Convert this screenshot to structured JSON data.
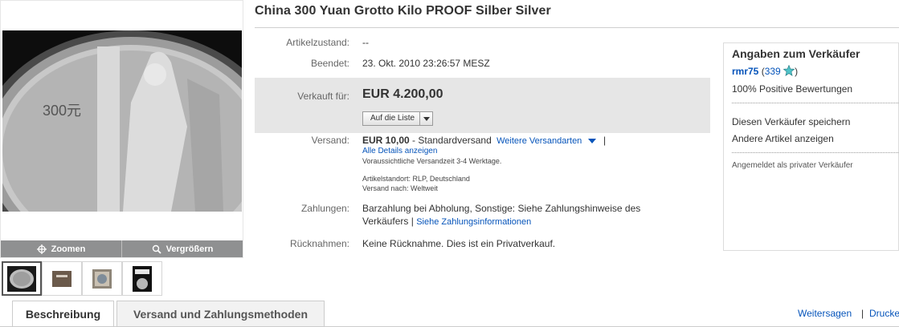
{
  "title": "China 300 Yuan Grotto Kilo PROOF Silber Silver",
  "gallery": {
    "zoom_label": "Zoomen",
    "enlarge_label": "Vergrößern",
    "coin_denomination": "300元",
    "thumb_count": 4
  },
  "details": {
    "condition_label": "Artikelzustand:",
    "condition_value": "--",
    "ended_label": "Beendet:",
    "ended_value": "23. Okt. 2010 23:26:57 MESZ",
    "sold_label": "Verkauft für:",
    "sold_value": "EUR 4.200,00",
    "watch_label": "Auf die Liste",
    "shipping_label": "Versand:",
    "shipping_price": "EUR 10,00",
    "shipping_method": " - Standardversand",
    "shipping_more": "Weitere Versandarten",
    "shipping_all_details": "Alle Details anzeigen",
    "shipping_time": "Voraussichtliche Versandzeit 3-4 Werktage.",
    "item_location": "Artikelstandort: RLP, Deutschland",
    "ships_to": "Versand nach: Weltweit",
    "payment_label": "Zahlungen:",
    "payment_value": "Barzahlung bei Abholung, Sonstige: Siehe Zahlungshinweise des",
    "payment_value_2": "Verkäufers",
    "payment_link": "Siehe Zahlungsinformationen",
    "returns_label": "Rücknahmen:",
    "returns_value": "Keine Rücknahme. Dies ist ein Privatverkauf."
  },
  "seller": {
    "heading": "Angaben zum Verkäufer",
    "name": "rmr75",
    "feedback_score": "339",
    "positive": "100% Positive Bewertungen",
    "save_seller": "Diesen Verkäufer speichern",
    "other_items": "Andere Artikel anzeigen",
    "registered_as": "Angemeldet als privater Verkäufer"
  },
  "tabs": {
    "description": "Beschreibung",
    "shipping_payment": "Versand und Zahlungsmethoden"
  },
  "share": {
    "share_label": "Weitersagen",
    "print_label": "Drucken"
  },
  "colors": {
    "link": "#0654ba",
    "price_box": "#e6e6e6",
    "zoom_bar": "#8f9091"
  }
}
